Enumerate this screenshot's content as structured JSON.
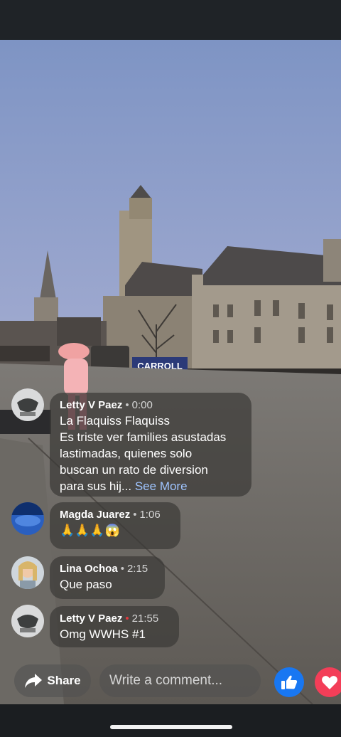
{
  "video": {
    "banner_text": "CARROLL"
  },
  "comments": [
    {
      "author": "Letty V Paez",
      "time": "0:00",
      "lines": [
        "La Flaquiss Flaquiss",
        "Es triste ver families asustadas",
        "lastimadas, quienes solo",
        "buscan un rato de diversion",
        "para sus hij..."
      ],
      "see_more": "See More"
    },
    {
      "author": "Magda Juarez",
      "time": "1:06",
      "text": "🙏🙏🙏😱"
    },
    {
      "author": "Lina Ochoa",
      "time": "2:15",
      "text": "Que paso"
    },
    {
      "author": "Letty V Paez",
      "time": "21:55",
      "text": "Omg WWHS #1"
    }
  ],
  "actions": {
    "share_label": "Share",
    "comment_placeholder": "Write a comment...",
    "like_icon": "thumbs-up-icon",
    "love_icon": "heart-icon"
  },
  "colors": {
    "like": "#1877f2",
    "love": "#f33e58",
    "see_more": "#9fc4ff"
  }
}
